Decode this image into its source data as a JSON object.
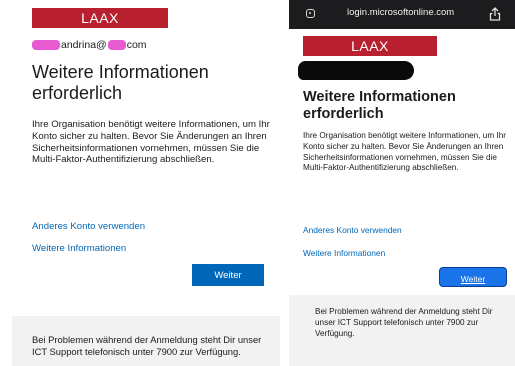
{
  "left": {
    "logo": "LAAX",
    "account": {
      "visible_before": "",
      "part1": "andrina@",
      "part2": "com"
    },
    "title": "Weitere Informationen erforderlich",
    "description": "Ihre Organisation benötigt weitere Informationen, um Ihr Konto sicher zu halten. Bevor Sie Änderungen an Ihren Sicherheitsinformationen vornehmen, müssen Sie die Multi-Faktor-Authentifizierung abschließen.",
    "link_other_account": "Anderes Konto verwenden",
    "link_more_info": "Weitere Informationen",
    "next_button": "Weiter",
    "footer": "Bei Problemen während der Anmeldung steht Dir unser ICT Support telefonisch unter 7900 zur Verfügung."
  },
  "right": {
    "browser": {
      "url": "login.microsoftonline.com"
    },
    "logo": "LAAX",
    "title": "Weitere Informationen erforderlich",
    "description": "Ihre Organisation benötigt weitere Informationen, um Ihr Konto sicher zu halten. Bevor Sie Änderungen an Ihren Sicherheitsinformationen vornehmen, müssen Sie die Multi-Faktor-Authentifizierung abschließen.",
    "link_other_account": "Anderes Konto verwenden",
    "link_more_info": "Weitere Informationen",
    "next_button": "Weiter",
    "footer": "Bei Problemen während der Anmeldung steht Dir unser ICT Support telefonisch unter 7900 zur Verfügung."
  },
  "colors": {
    "brand_red": "#b8202f",
    "link_blue": "#0067b8",
    "button_blue": "#0067b8",
    "footer_gray": "#f2f2f2",
    "browser_bar": "#1c1c1e"
  }
}
